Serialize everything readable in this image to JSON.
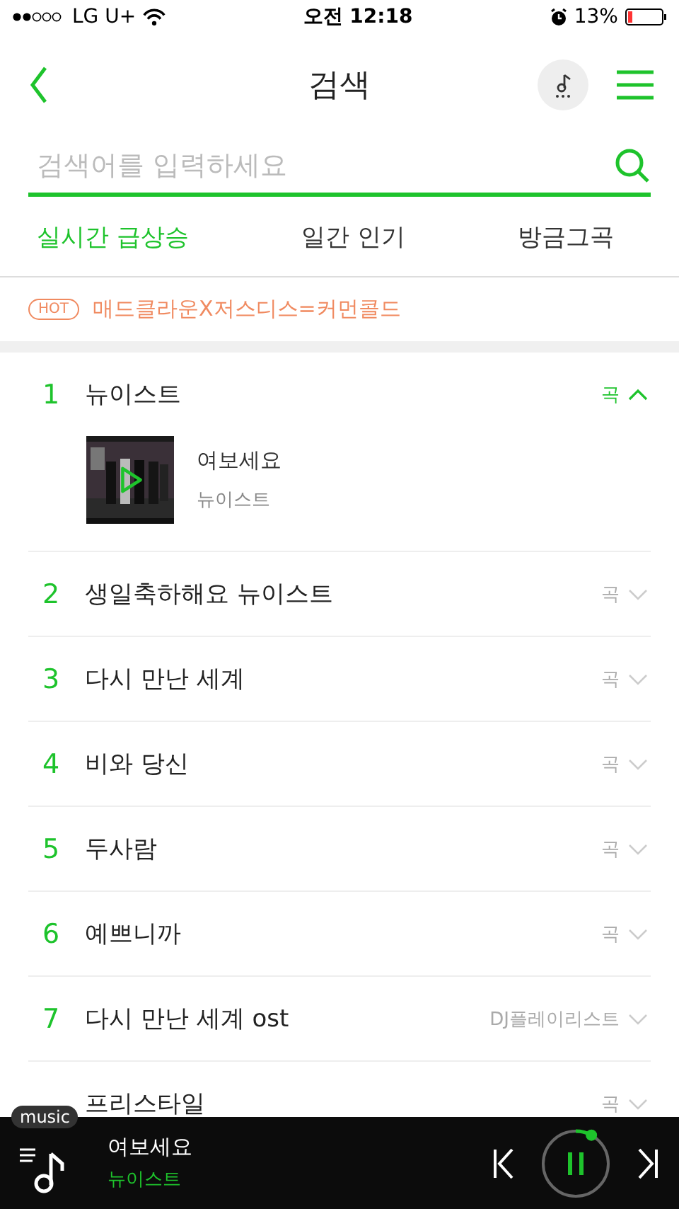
{
  "status_bar": {
    "carrier": "LG U+",
    "time": "오전 12:18",
    "battery": "13%"
  },
  "header": {
    "title": "검색"
  },
  "search": {
    "placeholder": "검색어를 입력하세요"
  },
  "tabs": [
    {
      "label": "실시간 급상승",
      "selected": true
    },
    {
      "label": "일간 인기",
      "selected": false
    },
    {
      "label": "방금그곡",
      "selected": false
    }
  ],
  "hot": {
    "badge": "HOT",
    "text": "매드클라운X저스디스=커먼콜드"
  },
  "results": [
    {
      "rank": "1",
      "title": "뉴이스트",
      "type": "곡",
      "expanded": true,
      "song": {
        "title": "여보세요",
        "artist": "뉴이스트"
      }
    },
    {
      "rank": "2",
      "title": "생일축하해요 뉴이스트",
      "type": "곡",
      "expanded": false
    },
    {
      "rank": "3",
      "title": "다시 만난 세계",
      "type": "곡",
      "expanded": false
    },
    {
      "rank": "4",
      "title": "비와 당신",
      "type": "곡",
      "expanded": false
    },
    {
      "rank": "5",
      "title": "두사람",
      "type": "곡",
      "expanded": false
    },
    {
      "rank": "6",
      "title": "예쁘니까",
      "type": "곡",
      "expanded": false
    },
    {
      "rank": "7",
      "title": "다시 만난 세계 ost",
      "type": "DJ플레이리스트",
      "expanded": false
    },
    {
      "title": "프리스타일",
      "type": "곡",
      "expanded": false
    }
  ],
  "player": {
    "badge": "music",
    "title": "여보세요",
    "artist": "뉴이스트",
    "playing": true
  }
}
